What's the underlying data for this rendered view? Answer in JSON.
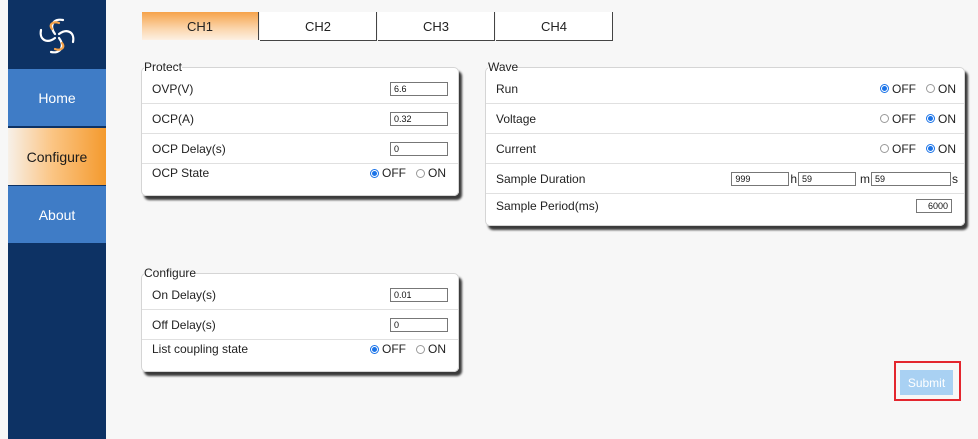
{
  "sidebar": {
    "logo_icon": "fan-swirl-icon",
    "items": [
      {
        "label": "Home"
      },
      {
        "label": "Configure"
      },
      {
        "label": "About"
      }
    ]
  },
  "tabs": [
    {
      "label": "CH1",
      "active": true
    },
    {
      "label": "CH2",
      "active": false
    },
    {
      "label": "CH3",
      "active": false
    },
    {
      "label": "CH4",
      "active": false
    }
  ],
  "protect": {
    "legend": "Protect",
    "ovp_label": "OVP(V)",
    "ovp_value": "6.6",
    "ocp_label": "OCP(A)",
    "ocp_value": "0.32",
    "ocp_delay_label": "OCP Delay(s)",
    "ocp_delay_value": "0",
    "ocp_state_label": "OCP State",
    "ocp_state": "OFF"
  },
  "configure": {
    "legend": "Configure",
    "on_delay_label": "On Delay(s)",
    "on_delay_value": "0.01",
    "off_delay_label": "Off Delay(s)",
    "off_delay_value": "0",
    "list_coupling_label": "List coupling state",
    "list_coupling_state": "OFF"
  },
  "wave": {
    "legend": "Wave",
    "run_label": "Run",
    "run_state": "OFF",
    "voltage_label": "Voltage",
    "voltage_state": "ON",
    "current_label": "Current",
    "current_state": "ON",
    "sample_duration_label": "Sample Duration",
    "duration_h": "999",
    "duration_m": "59",
    "duration_s": "59",
    "unit_h": "h",
    "unit_m": "m",
    "unit_s": "s",
    "sample_period_label": "Sample Period(ms)",
    "sample_period_value": "6000"
  },
  "radio_labels": {
    "off": "OFF",
    "on": "ON"
  },
  "submit_label": "Submit",
  "colors": {
    "sidebar_bg": "#0d3264",
    "nav_item_bg": "#3f7cc6",
    "active_accent": "#f49a2e",
    "radio_selected": "#1a73e8",
    "submit_bg": "#a9d1f3",
    "highlight_border": "#e3262e"
  }
}
